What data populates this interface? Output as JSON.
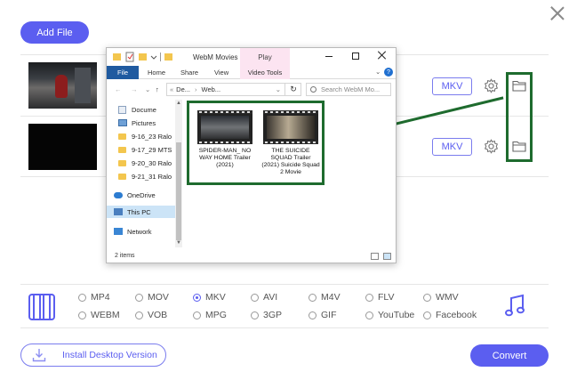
{
  "toolbar": {
    "add_file_label": "Add File"
  },
  "files": [
    {
      "format": "MKV"
    },
    {
      "format": "MKV"
    }
  ],
  "explorer": {
    "title": "WebM Movies",
    "play_tab": "Play",
    "ribbon_tabs": [
      "File",
      "Home",
      "Share",
      "View",
      "Video Tools"
    ],
    "breadcrumb": [
      "De...",
      "Web..."
    ],
    "search_placeholder": "Search WebM Mo...",
    "nav_items": [
      "Docume",
      "Pictures",
      "9-16_23 Ralo",
      "9-17_29 MTS",
      "9-20_30 Ralo",
      "9-21_31 Ralo",
      "OneDrive",
      "This PC",
      "Network"
    ],
    "files": [
      {
        "name": "SPIDER-MAN_ NO WAY HOME Trailer (2021)"
      },
      {
        "name": "THE SUICIDE SQUAD Trailer (2021) Suicide Squad 2 Movie"
      }
    ],
    "status_count": "2 items"
  },
  "formats": {
    "selected": "MKV",
    "row1": [
      "MP4",
      "MOV",
      "MKV",
      "AVI",
      "M4V",
      "FLV",
      "WMV"
    ],
    "row2": [
      "WEBM",
      "VOB",
      "MPG",
      "3GP",
      "GIF",
      "YouTube",
      "Facebook"
    ]
  },
  "footer": {
    "install_label": "Install Desktop Version",
    "convert_label": "Convert"
  },
  "colors": {
    "accent": "#5b5ef0",
    "highlight_green": "#1e6b2e",
    "file_tab": "#1f5aa0"
  }
}
